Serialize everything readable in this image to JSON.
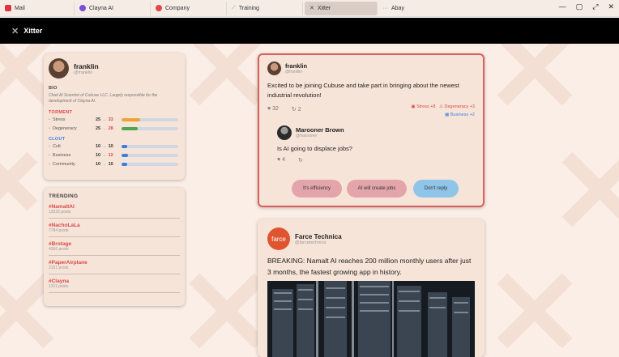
{
  "tabs": [
    {
      "label": "Mail",
      "color": "#d34"
    },
    {
      "label": "Clayna AI",
      "color": "#7b4fd8"
    },
    {
      "label": "Company",
      "color": "#e04848"
    },
    {
      "label": "Training",
      "color": "#4a9"
    },
    {
      "label": "Xitter",
      "color": "#222"
    },
    {
      "label": "Abay",
      "color": "#888"
    }
  ],
  "app": {
    "title": "Xitter"
  },
  "profile": {
    "name": "franklin",
    "handle": "@franklin",
    "bio_label": "BIO",
    "bio": "Chief AI Scientist of Cubuse LLC. Largely responsible for the development of Clayna AI.",
    "torment_label": "TORMENT",
    "torment": [
      {
        "label": "Stress",
        "from": "25",
        "to": "33",
        "level": 0.33,
        "color": "#f0a23a"
      },
      {
        "label": "Degeneracy",
        "from": "25",
        "to": "28",
        "level": 0.28,
        "color": "#4ca84c"
      }
    ],
    "clout_label": "CLOUT",
    "clout": [
      {
        "label": "Cult",
        "from": "10",
        "to": "10",
        "level": 0.1,
        "color": "#3d7de0"
      },
      {
        "label": "Business",
        "from": "10",
        "to": "12",
        "level": 0.12,
        "color": "#3d7de0"
      },
      {
        "label": "Community",
        "from": "10",
        "to": "10",
        "level": 0.1,
        "color": "#3d7de0"
      }
    ]
  },
  "trending": {
    "title": "TRENDING",
    "items": [
      {
        "tag": "#NamaltAI",
        "count": "13222 posts"
      },
      {
        "tag": "#NachoLaLa",
        "count": "7784 posts"
      },
      {
        "tag": "#Brotage",
        "count": "4366 posts"
      },
      {
        "tag": "#PaperAirplane",
        "count": "2101 posts"
      },
      {
        "tag": "#Clayna",
        "count": "1311 posts"
      }
    ]
  },
  "post1": {
    "name": "franklin",
    "handle": "@franklin",
    "text": "Excited to be joining Cubuse and take part in bringing about the newest industrial revolution!",
    "likes": "32",
    "reposts": "2",
    "effects": [
      "Stress +8",
      "Degeneracy +3",
      "Business +2"
    ],
    "reply": {
      "name": "Marooner Brown",
      "handle": "@marooner",
      "text": "Is AI going to displace jobs?",
      "likes": "4"
    },
    "options": [
      "It's efficiency",
      "AI will create jobs",
      "Don't reply"
    ]
  },
  "post2": {
    "name": "Farce Technica",
    "handle": "@farcetechnica",
    "avatar_text": "farce",
    "text": "BREAKING: Namalt AI reaches 200 million monthly users after just 3 months, the fastest growing app in history."
  }
}
